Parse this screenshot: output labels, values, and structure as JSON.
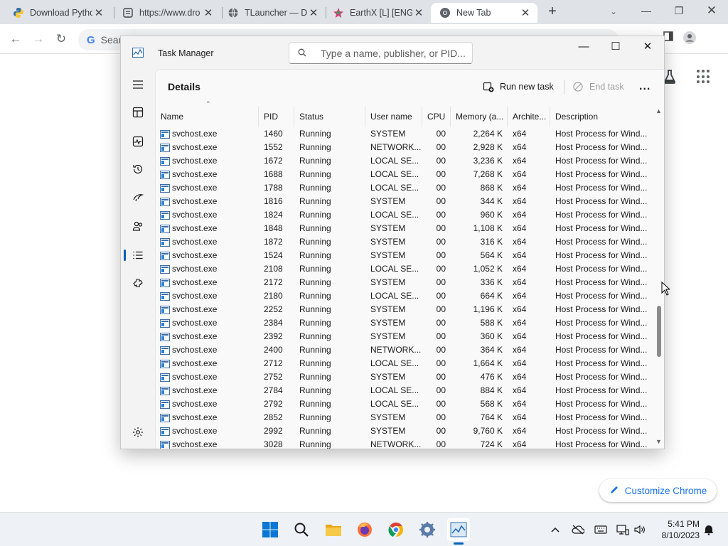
{
  "chrome": {
    "tabs": [
      {
        "title": "Download Pytho",
        "icon": "python-icon"
      },
      {
        "title": "https://www.dro",
        "icon": "page-icon"
      },
      {
        "title": "TLauncher — D",
        "icon": "globe-icon"
      },
      {
        "title": "EarthX [L] [ENG",
        "icon": "earthx-icon"
      },
      {
        "title": "New Tab",
        "icon": "chrome-icon",
        "active": true
      }
    ],
    "new_tab": "+",
    "omnibox_placeholder": "Sear",
    "customize_label": "Customize Chrome"
  },
  "task_manager": {
    "title": "Task Manager",
    "search_placeholder": "Type a name, publisher, or PID...",
    "page_title": "Details",
    "run_new_task": "Run new task",
    "end_task": "End task",
    "more": "...",
    "columns": [
      "Name",
      "PID",
      "Status",
      "User name",
      "CPU",
      "Memory (a...",
      "Archite...",
      "Description"
    ],
    "rows": [
      [
        "svchost.exe",
        "1460",
        "Running",
        "SYSTEM",
        "00",
        "2,264 K",
        "x64",
        "Host Process for Wind..."
      ],
      [
        "svchost.exe",
        "1552",
        "Running",
        "NETWORK...",
        "00",
        "2,928 K",
        "x64",
        "Host Process for Wind..."
      ],
      [
        "svchost.exe",
        "1672",
        "Running",
        "LOCAL SE...",
        "00",
        "3,236 K",
        "x64",
        "Host Process for Wind..."
      ],
      [
        "svchost.exe",
        "1688",
        "Running",
        "LOCAL SE...",
        "00",
        "7,268 K",
        "x64",
        "Host Process for Wind..."
      ],
      [
        "svchost.exe",
        "1788",
        "Running",
        "LOCAL SE...",
        "00",
        "868 K",
        "x64",
        "Host Process for Wind..."
      ],
      [
        "svchost.exe",
        "1816",
        "Running",
        "SYSTEM",
        "00",
        "344 K",
        "x64",
        "Host Process for Wind..."
      ],
      [
        "svchost.exe",
        "1824",
        "Running",
        "LOCAL SE...",
        "00",
        "960 K",
        "x64",
        "Host Process for Wind..."
      ],
      [
        "svchost.exe",
        "1848",
        "Running",
        "SYSTEM",
        "00",
        "1,108 K",
        "x64",
        "Host Process for Wind..."
      ],
      [
        "svchost.exe",
        "1872",
        "Running",
        "SYSTEM",
        "00",
        "316 K",
        "x64",
        "Host Process for Wind..."
      ],
      [
        "svchost.exe",
        "1524",
        "Running",
        "SYSTEM",
        "00",
        "564 K",
        "x64",
        "Host Process for Wind..."
      ],
      [
        "svchost.exe",
        "2108",
        "Running",
        "LOCAL SE...",
        "00",
        "1,052 K",
        "x64",
        "Host Process for Wind..."
      ],
      [
        "svchost.exe",
        "2172",
        "Running",
        "SYSTEM",
        "00",
        "336 K",
        "x64",
        "Host Process for Wind..."
      ],
      [
        "svchost.exe",
        "2180",
        "Running",
        "LOCAL SE...",
        "00",
        "664 K",
        "x64",
        "Host Process for Wind..."
      ],
      [
        "svchost.exe",
        "2252",
        "Running",
        "SYSTEM",
        "00",
        "1,196 K",
        "x64",
        "Host Process for Wind..."
      ],
      [
        "svchost.exe",
        "2384",
        "Running",
        "SYSTEM",
        "00",
        "588 K",
        "x64",
        "Host Process for Wind..."
      ],
      [
        "svchost.exe",
        "2392",
        "Running",
        "SYSTEM",
        "00",
        "360 K",
        "x64",
        "Host Process for Wind..."
      ],
      [
        "svchost.exe",
        "2400",
        "Running",
        "NETWORK...",
        "00",
        "364 K",
        "x64",
        "Host Process for Wind..."
      ],
      [
        "svchost.exe",
        "2712",
        "Running",
        "LOCAL SE...",
        "00",
        "1,664 K",
        "x64",
        "Host Process for Wind..."
      ],
      [
        "svchost.exe",
        "2752",
        "Running",
        "SYSTEM",
        "00",
        "476 K",
        "x64",
        "Host Process for Wind..."
      ],
      [
        "svchost.exe",
        "2784",
        "Running",
        "LOCAL SE...",
        "00",
        "884 K",
        "x64",
        "Host Process for Wind..."
      ],
      [
        "svchost.exe",
        "2792",
        "Running",
        "LOCAL SE...",
        "00",
        "568 K",
        "x64",
        "Host Process for Wind..."
      ],
      [
        "svchost.exe",
        "2852",
        "Running",
        "SYSTEM",
        "00",
        "764 K",
        "x64",
        "Host Process for Wind..."
      ],
      [
        "svchost.exe",
        "2992",
        "Running",
        "SYSTEM",
        "00",
        "9,760 K",
        "x64",
        "Host Process for Wind..."
      ],
      [
        "svchost.exe",
        "3028",
        "Running",
        "NETWORK...",
        "00",
        "724 K",
        "x64",
        "Host Process for Wind..."
      ]
    ]
  },
  "taskbar": {
    "time": "5:41 PM",
    "date": "8/10/2023"
  },
  "colors": {
    "accent": "#005fb8",
    "chrome_link": "#1a73e8"
  }
}
